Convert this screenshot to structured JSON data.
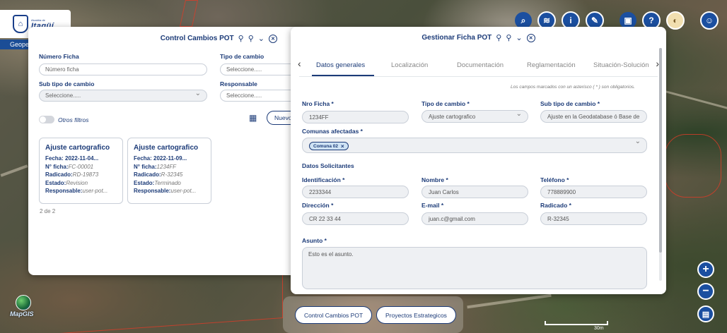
{
  "logo": {
    "small_text": "Alcaldía de",
    "big_text": "Itagüí"
  },
  "geo_tab_label": "Geope",
  "toolbar": {
    "buttons": [
      "search-icon",
      "layers-icon",
      "info-icon",
      "brush-icon",
      "briefcase-icon",
      "help-icon",
      "basemap-icon",
      "user-icon"
    ]
  },
  "left_panel": {
    "title": "Control Cambios POT",
    "fields": {
      "numero_ficha_label": "Número Ficha",
      "numero_ficha_placeholder": "Número ficha",
      "tipo_cambio_label": "Tipo de cambio",
      "tipo_cambio_value": "Seleccione.....",
      "sub_tipo_label": "Sub tipo de cambio",
      "sub_tipo_value": "Seleccione.....",
      "responsable_label": "Responsable",
      "responsable_value": "Seleccione....."
    },
    "otros_filtros": "Otros filtros",
    "nuevo_label": "Nuevo",
    "cards": [
      {
        "title": "Ajuste cartografico",
        "fecha_label": "Fecha:",
        "fecha": "2022-11-04...",
        "ficha_label": "N° ficha:",
        "ficha": "FC-00001",
        "radicado_label": "Radicado:",
        "radicado": "RD-19873",
        "estado_label": "Estado:",
        "estado": "Revision",
        "responsable_label": "Responsable:",
        "responsable": "user-pot..."
      },
      {
        "title": "Ajuste cartografico",
        "fecha_label": "Fecha:",
        "fecha": "2022-11-09...",
        "ficha_label": "N° ficha:",
        "ficha": "1234FF",
        "radicado_label": "Radicado:",
        "radicado": "R-32345",
        "estado_label": "Estado:",
        "estado": "Terminado",
        "responsable_label": "Responsable:",
        "responsable": "user-pot..."
      }
    ],
    "pager": "2 de 2"
  },
  "right_panel": {
    "title": "Gestionar Ficha POT",
    "tabs": [
      "Datos generales",
      "Localización",
      "Documentación",
      "Reglamentación",
      "Situación-Solución"
    ],
    "note": "Los campos marcados con un asterisco ( * ) son obligatorios.",
    "nro_ficha_label": "Nro Ficha *",
    "nro_ficha_value": "1234FF",
    "tipo_cambio_label": "Tipo de cambio *",
    "tipo_cambio_value": "Ajuste cartografico",
    "sub_tipo_label": "Sub tipo de cambio *",
    "sub_tipo_value": "Ajuste en la Geodatabase ó Base de",
    "comunas_label": "Comunas afectadas *",
    "comuna_chip": "Comuna 02",
    "solicitantes_title": "Datos Solicitantes",
    "identificacion_label": "Identificación *",
    "identificacion_value": "2233344",
    "nombre_label": "Nombre *",
    "nombre_value": "Juan Carlos",
    "telefono_label": "Teléfono *",
    "telefono_value": "778889900",
    "direccion_label": "Dirección *",
    "direccion_value": "CR 22 33 44",
    "email_label": "E-mail *",
    "email_value": "juan.c@gmail.com",
    "radicado_label": "Radicado *",
    "radicado_value": "R-32345",
    "asunto_label": "Asunto *",
    "asunto_value": "Esto es el asunto."
  },
  "bottom": {
    "control_btn": "Control Cambios POT",
    "proyectos_btn": "Proyectos Estrategicos"
  },
  "mapgis_label": "MapGIS",
  "scale_label": "30m"
}
